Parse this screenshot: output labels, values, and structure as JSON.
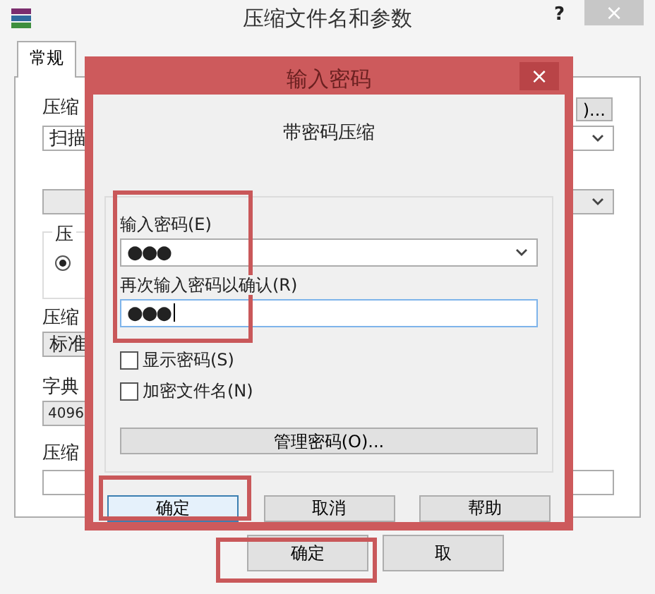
{
  "window": {
    "title": "压缩文件名和参数",
    "help": "?",
    "close": "×"
  },
  "tabs": [
    {
      "label": "常规",
      "selected": true
    }
  ],
  "background": {
    "archive_label": "压缩",
    "browse_button": ")...",
    "archive_field": "扫描",
    "group_label": "压",
    "radio": {
      "selected": true
    },
    "method_label": "压缩",
    "method_field": "标准",
    "dict_label": "字典",
    "dict_field": "4096",
    "split_label": "压缩"
  },
  "background_buttons": [
    "确定",
    "取"
  ],
  "dialog": {
    "title": "输入密码",
    "close": "×",
    "heading": "带密码压缩",
    "password_label": "输入密码(E)",
    "password": "●●●",
    "confirm_label": "再次输入密码以确认(R)",
    "confirm": "●●●",
    "checkboxes": [
      {
        "label": "显示密码(S)",
        "checked": false
      },
      {
        "label": "加密文件名(N)",
        "checked": false
      }
    ],
    "manage_button": "管理密码(O)...",
    "buttons": [
      {
        "label": "确定",
        "focused": true
      },
      {
        "label": "取消",
        "focused": false
      },
      {
        "label": "帮助",
        "focused": false
      }
    ]
  }
}
